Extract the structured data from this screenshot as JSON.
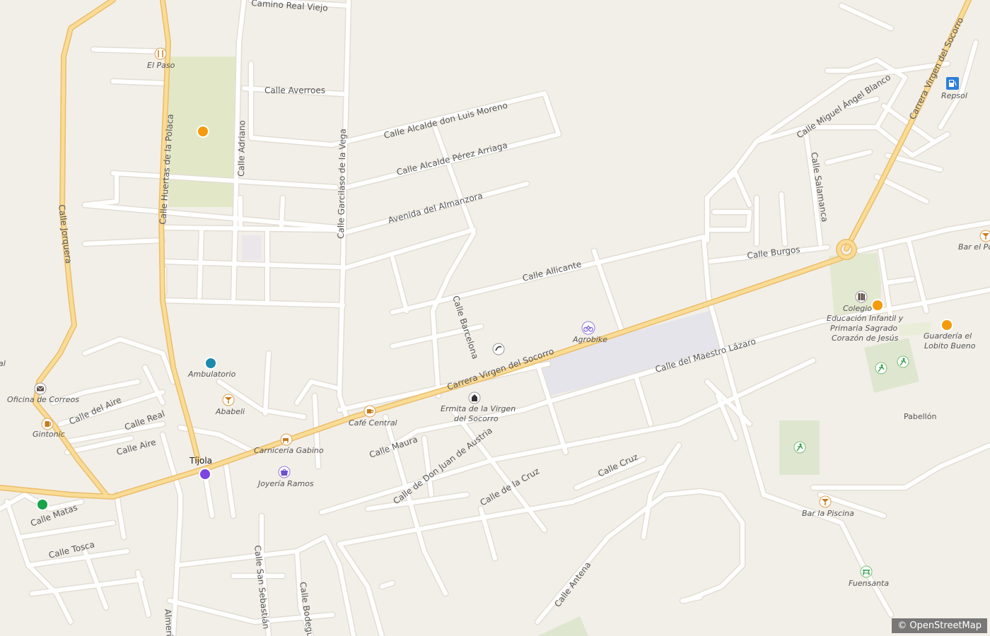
{
  "map": {
    "place": "Tíjola",
    "attribution": "© OpenStreetMap",
    "colors": {
      "background": "#f2efe9",
      "street": "#ffffff",
      "street_casing": "#e3ddd3",
      "main_road": "#f9dc96",
      "main_road_casing": "#ebbd6a",
      "park": "#e2e8c7",
      "pitch": "#dfe6d0",
      "parking": "#e4e4ea",
      "poi_orange": "#f49a0c",
      "poi_blue": "#1d8aae",
      "poi_green": "#1aa34a",
      "poi_purple": "#7b45e0"
    }
  },
  "streets": {
    "camino_real_viejo": "Camino Real Viejo",
    "calle_averroes": "Calle Averroes",
    "calle_alcalde_don_luis_moreno": "Calle Alcalde don Luis Moreno",
    "calle_alcalde_perez_arriaga": "Calle Alcalde Pérez Arriaga",
    "avenida_del_almanzora": "Avenida del Almanzora",
    "calle_adriano": "Calle Adriano",
    "calle_huertas_de_la_polaca": "Calle Huertas de la Polaca",
    "calle_jorquera": "Calle Jorquera",
    "calle_garcilaso_de_la_vega": "Calle Garcilaso de la Vega",
    "calle_allicante": "Calle Allicante",
    "calle_barcelona": "Calle Barcelona",
    "carrera_virgen_del_socorro": "Carrera Virgen del Socorro",
    "carrera_virgen_del_socorro_ne": "Carrera Virgen del Socorro",
    "calle_miguel_angel_blanco": "Calle Miguel Ángel Blanco",
    "calle_salamanca": "Calle Salamanca",
    "calle_burgos": "Calle Burgos",
    "calle_del_maestro_lazaro": "Calle del Maestro Lázaro",
    "calle_del_aire": "Calle del Aire",
    "calle_real": "Calle Real",
    "calle_aire": "Calle Aire",
    "calle_maura": "Calle Maura",
    "calle_de_don_juan_de_austria": "Calle de Don Juan de Austria",
    "calle_de_la_cruz": "Calle de la Cruz",
    "calle_cruz": "Calle Cruz",
    "calle_matas": "Calle Matas",
    "calle_tosca": "Calle Tosca",
    "calle_san_sebastian": "Calle San Sebastián",
    "calle_bodegui": "Calle Bodegui",
    "almeria": "Almería",
    "calle_antena": "Calle Antena"
  },
  "pois": {
    "el_paso": "El Paso",
    "ambulatorio": "Ambulatorio",
    "oficina_de_correos": "Oficina de Correos",
    "gintonic": "Gintonic",
    "ababeli": "Ababeli",
    "carniceria_gabino": "Carnicería Gabino",
    "cafe_central": "Café Central",
    "joyeria_ramos": "Joyería Ramos",
    "ermita_line1": "Ermita de la Virgen",
    "ermita_line2": "del Socorro",
    "agrobike": "Agrobike",
    "repsol": "Repsol",
    "bar_el_po": "Bar el Po",
    "colegio_line1": "Colegio",
    "colegio_line2": "Educación Infantil y",
    "colegio_line3": "Primaria Sagrado",
    "colegio_line4": "Corazón de Jesús",
    "guarderia_line1": "Guardería el",
    "guarderia_line2": "Lobito Bueno",
    "pabellon": "Pabellón",
    "bar_la_piscina": "Bar la Piscina",
    "fuensanta": "Fuensanta",
    "left_edge_fragment": "al"
  },
  "icons": {
    "restaurant": "fork-knife-icon",
    "post_office": "envelope-icon",
    "bar": "cocktail-glass-icon",
    "butcher": "cow-icon",
    "cafe": "coffee-cup-icon",
    "jewelry": "shopping-bag-icon",
    "church": "chapel-icon",
    "telephone": "telephone-icon",
    "bicycle": "bicycle-icon",
    "fuel": "fuel-pump-icon",
    "library": "books-icon",
    "sports": "running-figure-icon",
    "picnic": "picnic-table-icon",
    "beer": "beer-mug-icon"
  }
}
